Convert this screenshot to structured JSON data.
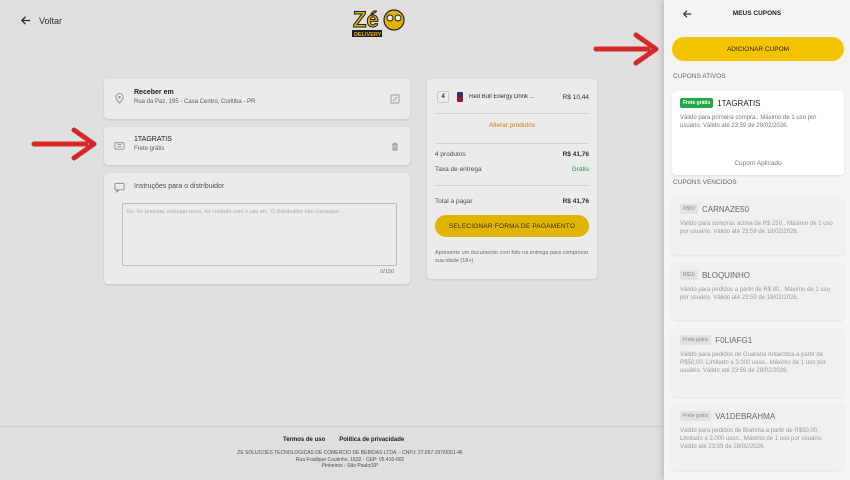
{
  "header": {
    "back_label": "Voltar",
    "logo_top": "Zé",
    "logo_bottom": "DELIVERY"
  },
  "address": {
    "title": "Receber em",
    "line": "Rua da Paz, 195 - Casa Centro, Curitiba - PR"
  },
  "applied_coupon": {
    "code": "1TAGRATIS",
    "subtitle": "Frete grátis"
  },
  "notes": {
    "label": "Instruções para o distribuidor",
    "placeholder": "Ex: Se precisar, entregar troco, ter cuidado com o cão etc. O distribuidor não consegue...",
    "counter": "0/150"
  },
  "cart": {
    "item": {
      "qty": "4",
      "name": "Red Bull Energy Drink ...",
      "price": "R$ 10,44"
    },
    "alter_label": "Alterar produtos",
    "products_label": "4 produtos",
    "products_value": "R$ 41,76",
    "delivery_label": "Taxa de entrega",
    "delivery_value": "Grátis",
    "total_label": "Total a pagar",
    "total_value": "R$ 41,76",
    "pay_button": "SELECIONAR FORMA DE PAGAMENTO",
    "note": "Apresente um documento com foto na entrega para comprovar sua idade (18+)"
  },
  "footer": {
    "terms": "Termos de uso",
    "privacy": "Política de privacidade",
    "line1": "ZE SOLUCOES TECNOLOGICAS DE COMERCIO DE BEBIDAS LTDA. - CNPJ: 27.657.197/0001-46",
    "line2": "Rua Fradique Coutinho, 1632 - CEP: 05.416-002",
    "line3": "Pinheiros - São Paulo/SP"
  },
  "panel": {
    "title": "MEUS CUPONS",
    "add_button": "ADICIONAR CUPOM",
    "active_label": "CUPONS ATIVOS",
    "expired_label": "CUPONS VENCIDOS",
    "active": [
      {
        "tag": "Frete grátis",
        "code": "1TAGRATIS",
        "desc": "Válido para primeira compra.. Máximo de 1 uso por usuário. Válido até 23:59 de 28/02/2026.",
        "status": "Cupom Aplicado"
      }
    ],
    "expired": [
      {
        "tag": "R$50",
        "code": "CARNAZE50",
        "desc": "Válido para compras acima de R$ 250.. Máximo de 1 uso por usuário. Válido até 23:59 de 18/02/2026."
      },
      {
        "tag": "R$15",
        "code": "BLOQUINHO",
        "desc": "Válido para pedidos a partir de R$ 80.. Máximo de 1 uso por usuário. Válido até 23:59 de 18/02/2026."
      },
      {
        "tag": "Frete grátis",
        "code": "F0LIAFG1",
        "desc": "Válido para pedidos de Guaraná Antarctica a partir de R$50,00. Limitado a 3.000 usos.. Máximo de 1 uso por usuário. Válido até 23:59 de 28/02/2026."
      },
      {
        "tag": "Frete grátis",
        "code": "VA1DEBRAHMA",
        "desc": "Válido para pedidos de Brahma a partir de R$50,00. Limitado a 2.000 usos.. Máximo de 1 uso por usuário. Válido até 23:59 de 28/02/2026."
      }
    ]
  },
  "colors": {
    "accent_yellow": "#f5c400",
    "active_green": "#23a847",
    "annotation_red": "#d62828"
  }
}
